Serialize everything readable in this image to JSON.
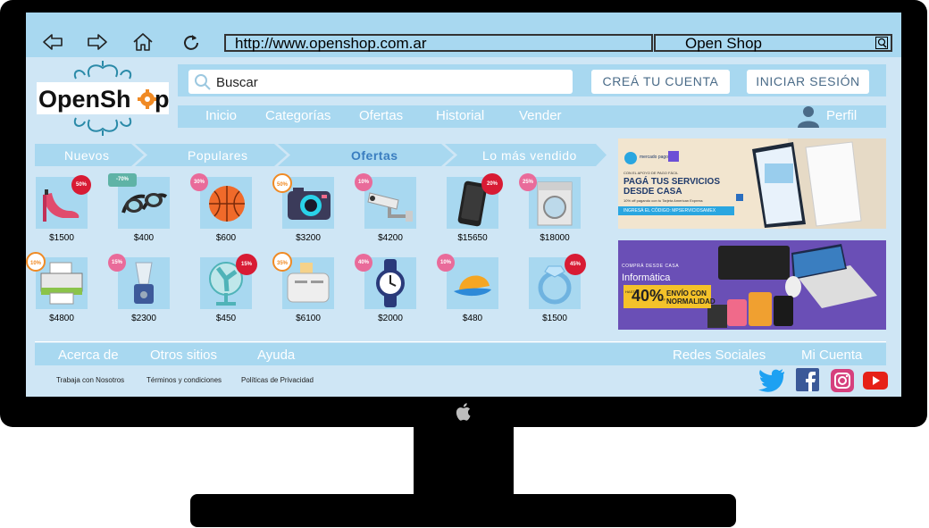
{
  "browser": {
    "url": "http://www.openshop.com.ar",
    "tab_title": "Open Shop"
  },
  "brand": {
    "logo_text_open": "OpenSh",
    "logo_text_p": "p"
  },
  "header": {
    "search_placeholder": "Buscar",
    "create_account": "CREÁ TU CUENTA",
    "login": "INICIAR SESIÓN"
  },
  "menu": {
    "items": [
      "Inicio",
      "Categorías",
      "Ofertas",
      "Historial",
      "Vender"
    ],
    "profile": "Perfil"
  },
  "categories": [
    "Nuevos",
    "Populares",
    "Ofertas",
    "Lo más vendido"
  ],
  "products_row1": [
    {
      "name": "tacon",
      "price": "$1500",
      "badge": "50%"
    },
    {
      "name": "antiparras",
      "price": "$400",
      "badge": "-70%"
    },
    {
      "name": "pelota",
      "price": "$600",
      "badge": "30%"
    },
    {
      "name": "camara",
      "price": "$3200",
      "badge": "50%"
    },
    {
      "name": "camara-seguridad",
      "price": "$4200",
      "badge": "10%"
    },
    {
      "name": "celular",
      "price": "$15650",
      "badge": "20%"
    },
    {
      "name": "lavarropas",
      "price": "$18000",
      "badge": "25%"
    }
  ],
  "products_row2": [
    {
      "name": "impresora",
      "price": "$4800",
      "badge": "10%"
    },
    {
      "name": "licuadora",
      "price": "$2300",
      "badge": "15%"
    },
    {
      "name": "ventilador",
      "price": "$450",
      "badge": "15%"
    },
    {
      "name": "tostadora",
      "price": "$6100",
      "badge": "35%"
    },
    {
      "name": "reloj",
      "price": "$2000",
      "badge": "40%"
    },
    {
      "name": "gorra",
      "price": "$480",
      "badge": "10%"
    },
    {
      "name": "anillo",
      "price": "$1500",
      "badge": "45%"
    }
  ],
  "banner1": {
    "brand": "mercado pago",
    "line1": "CON EL APOYO DE PAGO FÁCIL",
    "headline1": "PAGÁ TUS SERVICIOS",
    "headline2": "DESDE CASA",
    "small": "10% off pagando con tu Tarjeta American Express",
    "code": "INGRESÁ EL CÓDIGO: MPSERVICIOSAMEX"
  },
  "banner2": {
    "top": "COMPRÁ DESDE CASA",
    "title": "Informática",
    "discount": "40%",
    "off": "OFF",
    "hasta": "HASTA",
    "shipping1": "ENVÍO CON",
    "shipping2": "NORMALIDAD"
  },
  "footer": {
    "about": "Acerca de",
    "other_sites": "Otros sitios",
    "help": "Ayuda",
    "social": "Redes Sociales",
    "account": "Mi Cuenta",
    "legal": [
      "Trabaja con Nosotros",
      "Términos y condiciones",
      "Políticas de Privacidad"
    ]
  },
  "colors": {
    "page_bg": "#cfe6f5",
    "bar_bg": "#a8d8f0",
    "accent_orange": "#f08a24",
    "badge_red": "#d81b34",
    "badge_pink": "#e96b9a"
  }
}
